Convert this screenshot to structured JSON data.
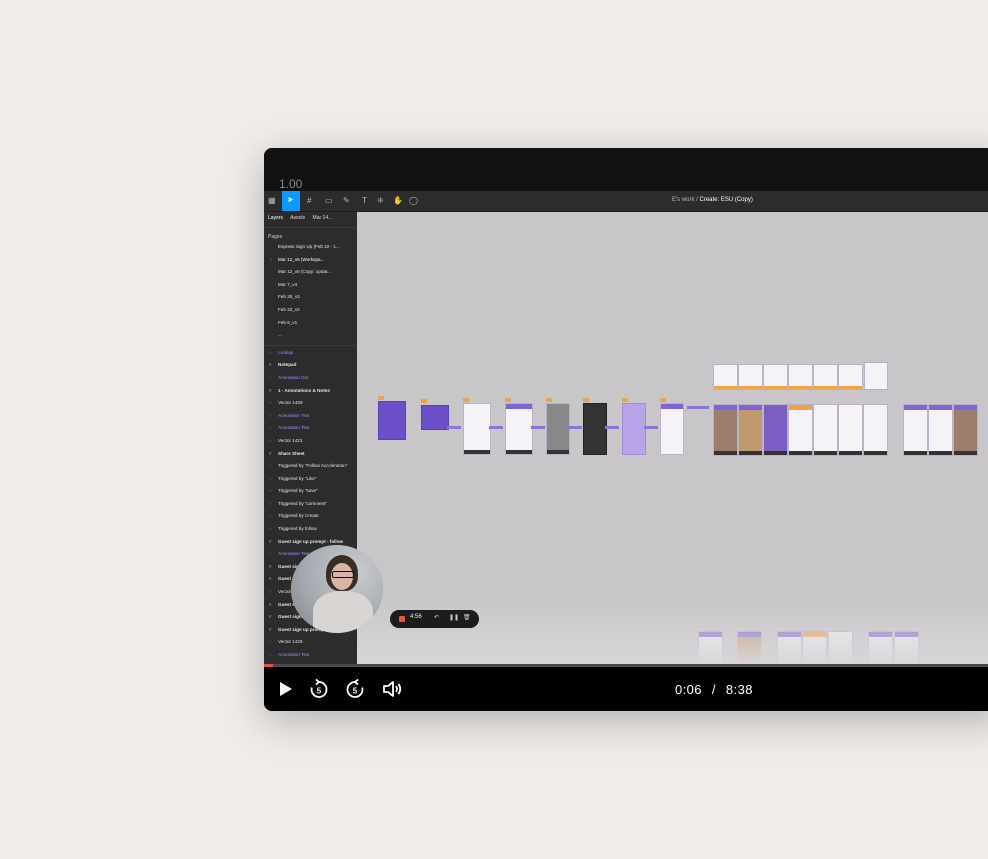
{
  "player": {
    "speed": "1.00",
    "current_time": "0:06",
    "separator": "/",
    "duration": "8:38",
    "progress_fraction": 0.012,
    "accent_color": "#e8543f",
    "controls": [
      "play-icon",
      "rewind-5-icon",
      "forward-5-icon",
      "volume-icon"
    ]
  },
  "app": {
    "breadcrumb_team": "E's work",
    "breadcrumb_sep": "/",
    "file_name": "Create: ESU (Copy)",
    "tab_layers": "Layers",
    "tab_assets": "Assets",
    "tab_page": "Mar 14...",
    "pages_label": "Pages",
    "pages": [
      "Express Sign Up (Feb 22 - 1...",
      "Mar 12_v5 (Workspa...",
      "Mar 12_v5 (Copy: updat...",
      "Mar 7_v4",
      "Feb 28_v3",
      "Feb 22_v2",
      "Feb 6_v1",
      "..."
    ],
    "layers": [
      {
        "text": "Lookup",
        "style": "purple"
      },
      {
        "text": "Notepad",
        "style": "bold"
      },
      {
        "text": "Annotation Dot",
        "style": "purple"
      },
      {
        "text": "1 - Annotations & Notes",
        "style": "bold"
      },
      {
        "text": "Vector 1429",
        "style": ""
      },
      {
        "text": "Annotation Text",
        "style": "purple"
      },
      {
        "text": "Annotation Text",
        "style": "purple"
      },
      {
        "text": "Vector 1421",
        "style": ""
      },
      {
        "text": "Share Sheet",
        "style": "bold"
      },
      {
        "text": "Triggered by \"Follow Acccleration\"",
        "style": ""
      },
      {
        "text": "Triggered by \"Like\"",
        "style": ""
      },
      {
        "text": "Triggered by \"save\"",
        "style": ""
      },
      {
        "text": "Triggered by \"comment\"",
        "style": ""
      },
      {
        "text": "Triggered by Create",
        "style": ""
      },
      {
        "text": "Triggered by follow",
        "style": ""
      },
      {
        "text": "Guest sign up prompt - follow",
        "style": "bold"
      },
      {
        "text": "Annotation Text",
        "style": "purple"
      },
      {
        "text": "Guest sign...",
        "style": "bold"
      },
      {
        "text": "Guest si...",
        "style": "bold"
      },
      {
        "text": "Vector 1...",
        "style": ""
      },
      {
        "text": "Guest sign...",
        "style": "bold"
      },
      {
        "text": "Guest sign up prompt...",
        "style": "bold"
      },
      {
        "text": "Guest sign up prompt...",
        "style": "bold"
      },
      {
        "text": "Vector 1426",
        "style": ""
      },
      {
        "text": "Annotation Text",
        "style": "purple"
      }
    ]
  },
  "recorder": {
    "elapsed": "4:56"
  }
}
